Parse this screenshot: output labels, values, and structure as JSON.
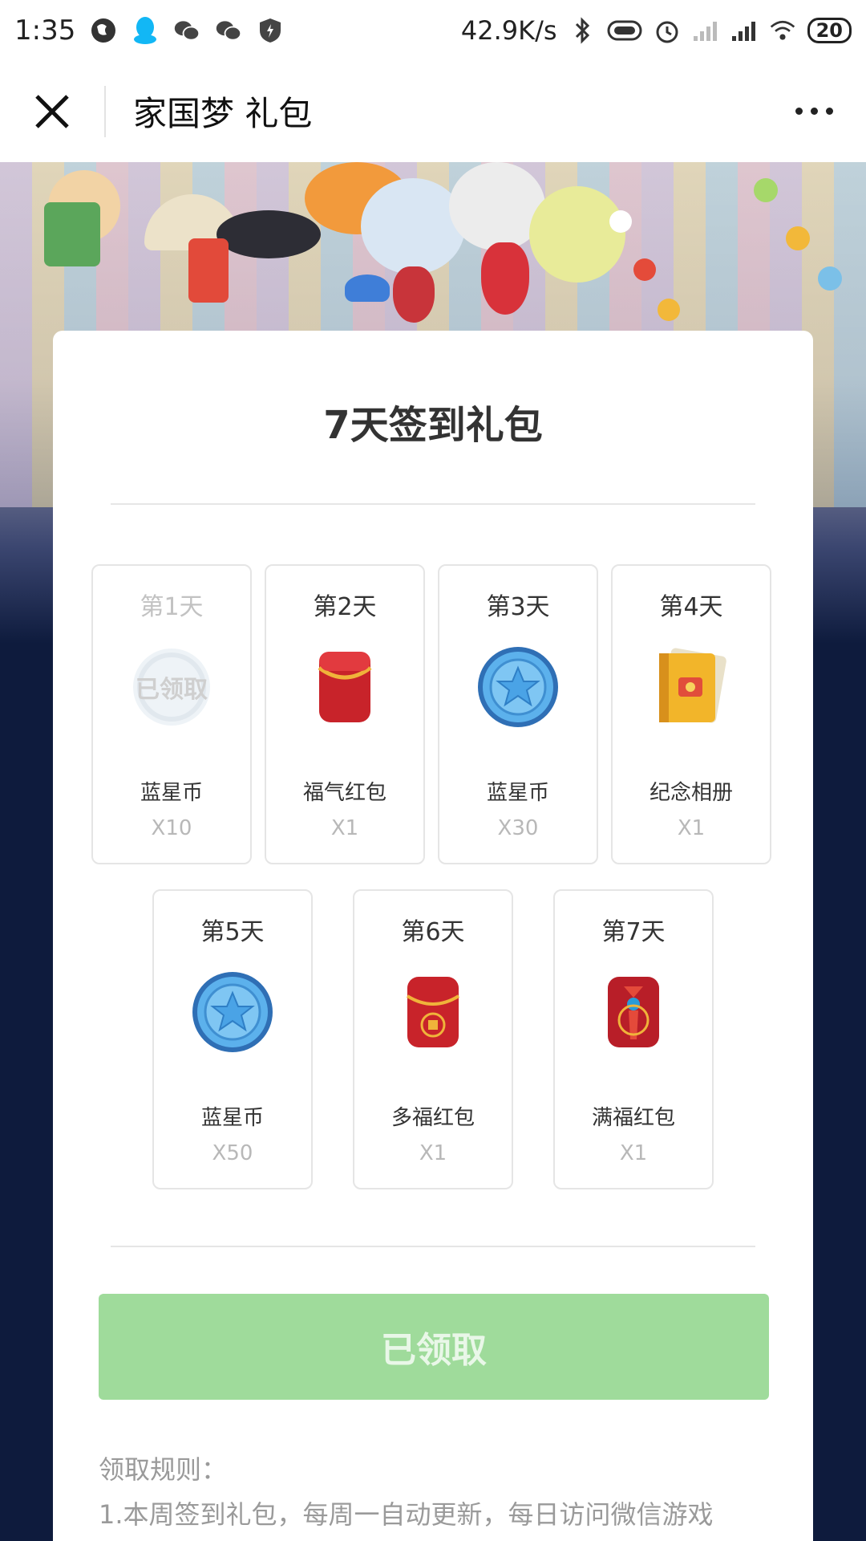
{
  "status_bar": {
    "time": "1:35",
    "net_speed": "42.9K/s",
    "battery": "20",
    "icons": [
      "globe-icon",
      "qq-icon",
      "wechat-icon",
      "wechat-icon",
      "shield-icon",
      "bluetooth-icon",
      "vibrate-icon",
      "alarm-icon",
      "signal-off-icon",
      "signal-icon",
      "wifi-icon",
      "battery-icon"
    ]
  },
  "nav": {
    "title": "家国梦 礼包",
    "close_icon": "close-icon",
    "more_icon": "more-icon"
  },
  "card": {
    "title": "7天签到礼包",
    "days": [
      {
        "label": "第1天",
        "name": "蓝星币",
        "qty": "X10",
        "icon": "blue-star-coin-icon",
        "claimed": true,
        "stamp": "已领取"
      },
      {
        "label": "第2天",
        "name": "福气红包",
        "qty": "X1",
        "icon": "red-envelope-icon",
        "claimed": false
      },
      {
        "label": "第3天",
        "name": "蓝星币",
        "qty": "X30",
        "icon": "blue-star-coin-icon",
        "claimed": false
      },
      {
        "label": "第4天",
        "name": "纪念相册",
        "qty": "X1",
        "icon": "photo-album-icon",
        "claimed": false
      },
      {
        "label": "第5天",
        "name": "蓝星币",
        "qty": "X50",
        "icon": "blue-star-coin-icon",
        "claimed": false
      },
      {
        "label": "第6天",
        "name": "多福红包",
        "qty": "X1",
        "icon": "fu-red-envelope-icon",
        "claimed": false
      },
      {
        "label": "第7天",
        "name": "满福红包",
        "qty": "X1",
        "icon": "knot-red-envelope-icon",
        "claimed": false
      }
    ],
    "claim_button": "已领取",
    "rules_title": "领取规则：",
    "rules_line1": "1.本周签到礼包，每周一自动更新，每日访问微信游戏"
  },
  "colors": {
    "accent_green": "#9fdb9b",
    "background_navy": "#0e1b3d",
    "muted_text": "#9a9a9a"
  }
}
